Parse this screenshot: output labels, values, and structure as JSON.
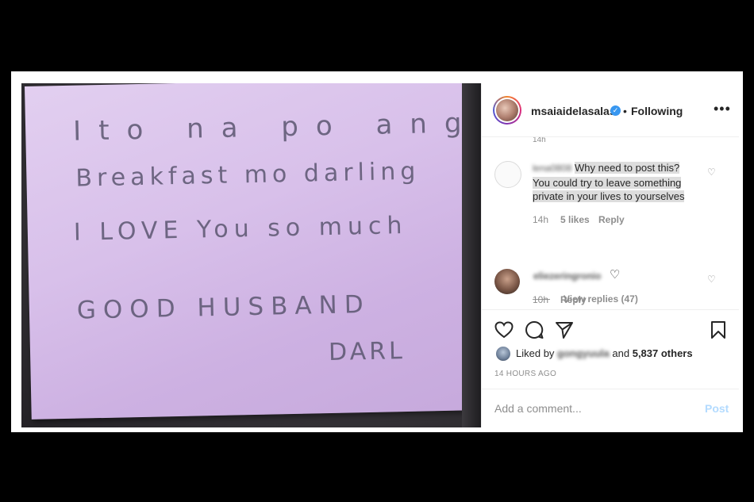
{
  "note": {
    "lines": [
      "Ito na po ang",
      "Breakfast mo darling",
      "I LOVE You so much",
      "GOOD HUSBAND",
      "DARL"
    ]
  },
  "header": {
    "username": "msaiaidelasalas",
    "verified_icon": "verified-badge-icon",
    "separator": "•",
    "follow_status": "Following",
    "more": "•••"
  },
  "comments": {
    "cut_off_time": "14h",
    "items": [
      {
        "username": "lena0808",
        "text": "Why need to post this? You could try to leave something private in your lives to yourselves",
        "time": "14h",
        "likes": "5 likes",
        "reply": "Reply",
        "view_replies": "View replies (47)"
      },
      {
        "username": "eliezeringronio",
        "time": "10h",
        "reply": "Reply"
      }
    ]
  },
  "actions": {
    "icons": [
      "heart-icon",
      "comment-icon",
      "share-icon",
      "bookmark-icon"
    ],
    "liked_prefix": "Liked by",
    "liked_user": "gongyuula",
    "liked_and": "and",
    "liked_others": "5,837 others",
    "time_ago": "14 HOURS AGO"
  },
  "add_comment": {
    "placeholder": "Add a comment...",
    "post_label": "Post"
  },
  "colors": {
    "post_disabled": "#b3dbff",
    "verified": "#3897f0",
    "note_paper": "#d8c0ea"
  }
}
